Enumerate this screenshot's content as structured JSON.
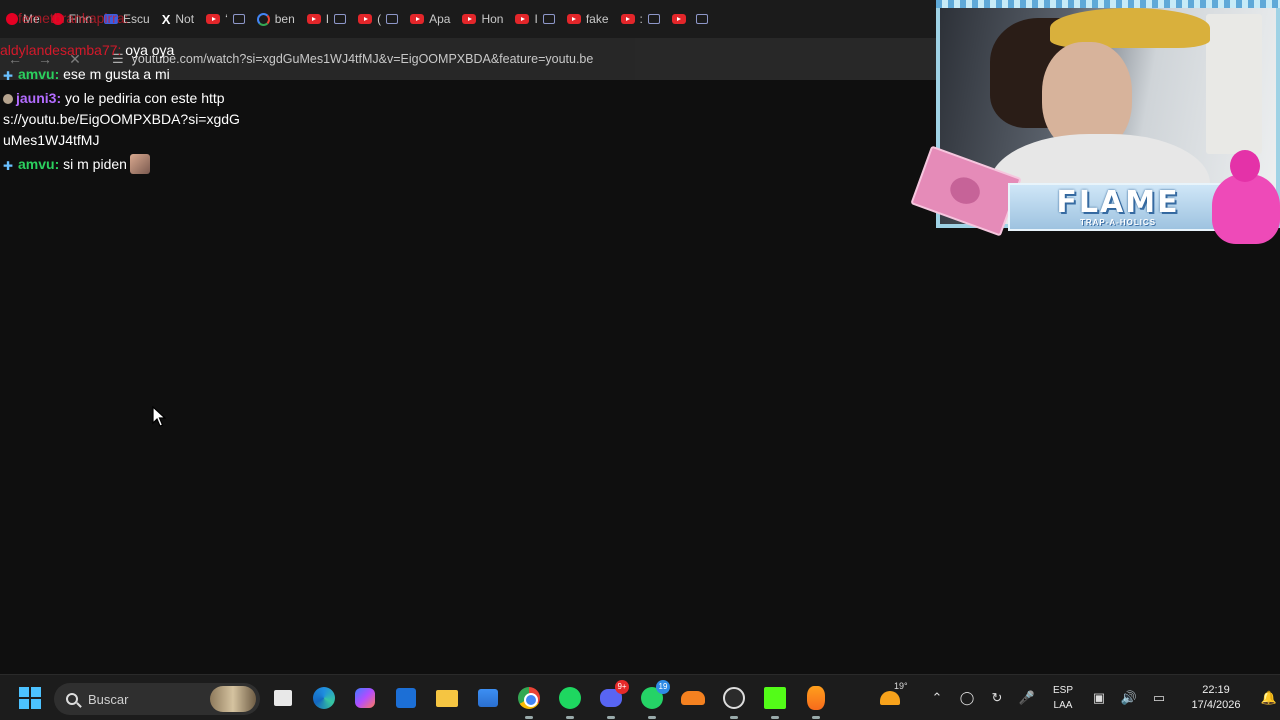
{
  "browser": {
    "tabs": [
      {
        "icon": "pinterest-icon",
        "label": "Me"
      },
      {
        "icon": "pinterest-icon",
        "label": "Finn"
      },
      {
        "icon": "minion-icon",
        "label": "Escu"
      },
      {
        "icon": "x-icon",
        "label": "Not"
      },
      {
        "icon": "youtube-icon",
        "label": "‘"
      },
      {
        "icon": "google-icon",
        "label": "ben"
      },
      {
        "icon": "youtube-icon",
        "label": "I"
      },
      {
        "icon": "youtube-icon",
        "label": "("
      },
      {
        "icon": "youtube-icon",
        "label": "Apa"
      },
      {
        "icon": "youtube-icon",
        "label": "Hon"
      },
      {
        "icon": "youtube-icon",
        "label": "I"
      },
      {
        "icon": "youtube-icon",
        "label": "fake"
      },
      {
        "icon": "youtube-icon",
        "label": ":"
      },
      {
        "icon": "youtube-icon",
        "label": ""
      }
    ],
    "address": "youtube.com/watch?si=xgdGuMes1WJ4tfMJ&v=EigOOMPXBDA&feature=youtu.be"
  },
  "chat": {
    "ghost_user": "fernetbrankapirra:",
    "top_message": {
      "user": "aldylandesamba77:",
      "text": " oya oya"
    },
    "messages": [
      {
        "badge": "sword-badge",
        "user": "amvu:",
        "user_color": "green",
        "text": " ese m gusta a mi"
      },
      {
        "badge": "hat-badge",
        "user": "jauni3:",
        "user_color": "purple",
        "text": " yo le pediria con este https://youtu.be/EigOOMPXBDA?si=xgdGuMes1WJ4tfMJ"
      },
      {
        "badge": "sword-badge",
        "user": "amvu:",
        "user_color": "green",
        "text": " si m piden",
        "emote": "face-emote"
      }
    ]
  },
  "overlay": {
    "banner_title": "FLAME",
    "banner_sub": "TRAP-A-HOLICS"
  },
  "taskbar": {
    "search_placeholder": "Buscar",
    "apps": [
      {
        "name": "task-view",
        "badge": ""
      },
      {
        "name": "edge",
        "badge": ""
      },
      {
        "name": "copilot",
        "badge": ""
      },
      {
        "name": "outlook",
        "badge": ""
      },
      {
        "name": "file-explorer",
        "badge": ""
      },
      {
        "name": "microsoft-store",
        "badge": ""
      },
      {
        "name": "chrome",
        "badge": ""
      },
      {
        "name": "spotify",
        "badge": ""
      },
      {
        "name": "discord",
        "badge": "9+"
      },
      {
        "name": "whatsapp",
        "badge": "19"
      },
      {
        "name": "cloudflare",
        "badge": ""
      },
      {
        "name": "obs",
        "badge": ""
      },
      {
        "name": "kick",
        "badge": ""
      },
      {
        "name": "fl-studio",
        "badge": ""
      }
    ],
    "weather_temp": "19°",
    "lang_line1": "ESP",
    "lang_line2": "LAA",
    "time": "22:19",
    "date": "17/4/2026"
  }
}
